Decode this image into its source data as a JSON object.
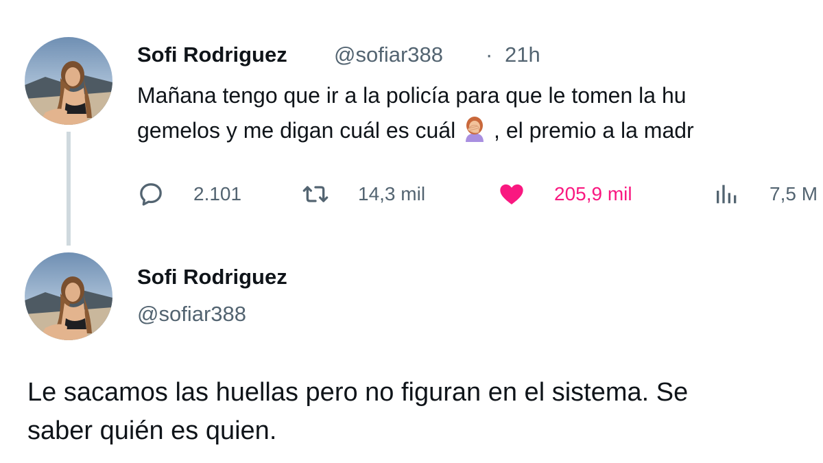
{
  "thread_tweet": {
    "display_name": "Sofi Rodriguez",
    "handle": "@sofiar388",
    "separator": "·",
    "time": "21h",
    "text_line1": "Mañana tengo que ir a la policía para que le tomen la hu",
    "text_line2_before": "gemelos y me digan cuál es cuál",
    "emoji": "facepalm-woman-emoji",
    "text_line2_after": " , el premio a la madr",
    "actions": {
      "reply_count": "2.101",
      "retweet_count": "14,3 mil",
      "like_count": "205,9 mil",
      "views_count": "7,5 M"
    }
  },
  "main_tweet": {
    "display_name": "Sofi Rodriguez",
    "handle": "@sofiar388",
    "text_line1": "Le sacamos las huellas pero no figuran en el sistema. Se",
    "text_line2": "saber quién es quien."
  },
  "colors": {
    "like_active": "#f91880",
    "secondary_text": "#536471",
    "primary_text": "#0f1419",
    "thread_line": "#cfd9de"
  },
  "icons": [
    "reply-icon",
    "retweet-icon",
    "heart-icon",
    "views-icon",
    "avatar-photo"
  ]
}
